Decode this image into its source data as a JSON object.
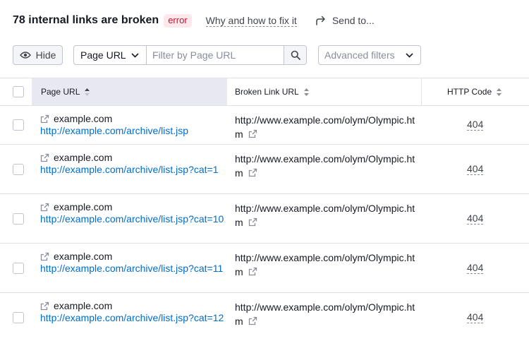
{
  "header": {
    "title": "78 internal links are broken",
    "badge": "error",
    "fix_link": "Why and how to fix it",
    "send_label": "Send to..."
  },
  "toolbar": {
    "hide_label": "Hide",
    "select_value": "Page URL",
    "filter_placeholder": "Filter by Page URL",
    "advanced_filters": "Advanced filters"
  },
  "table": {
    "columns": [
      "Page URL",
      "Broken Link URL",
      "HTTP Code"
    ],
    "rows": [
      {
        "domain": "example.com",
        "url": "http://example.com/archive/list.jsp",
        "broken": "http://www.example.com/olym/Olympic.htm",
        "code": "404"
      },
      {
        "domain": "example.com",
        "url": "http://example.com/archive/list.jsp?cat=1",
        "broken": "http://www.example.com/olym/Olympic.htm",
        "code": "404"
      },
      {
        "domain": "example.com",
        "url": "http://example.com/archive/list.jsp?cat=10",
        "broken": "http://www.example.com/olym/Olympic.htm",
        "code": "404"
      },
      {
        "domain": "example.com",
        "url": "http://example.com/archive/list.jsp?cat=11",
        "broken": "http://www.example.com/olym/Olympic.htm",
        "code": "404"
      },
      {
        "domain": "example.com",
        "url": "http://example.com/archive/list.jsp?cat=12",
        "broken": "http://www.example.com/olym/Olympic.htm",
        "code": "404"
      }
    ]
  },
  "icons": {
    "hide": "eye-icon",
    "send": "share-arrow-icon",
    "search": "search-icon",
    "dropdown": "chevron-down-icon",
    "external": "external-link-icon",
    "sort": "sort-icon"
  },
  "colors": {
    "link": "#006dca",
    "error_badge_bg": "#ffe8ec",
    "error_badge_text": "#c4122f",
    "active_header_bg": "#e8e9f0"
  }
}
